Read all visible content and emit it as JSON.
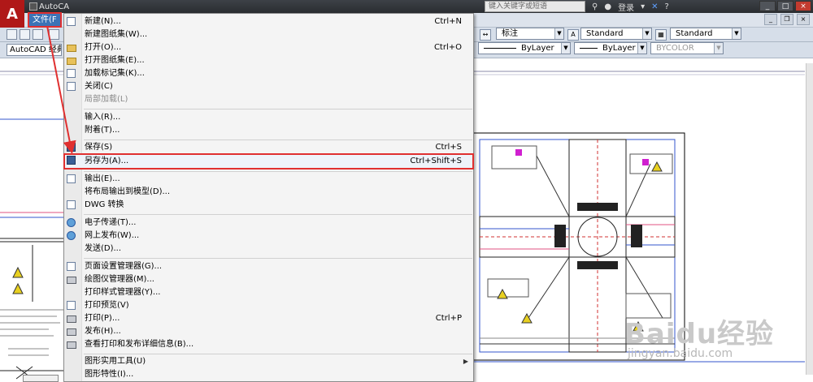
{
  "title_bar": {
    "doc_title": "AutoCA",
    "search_placeholder": "键入关键字或短语",
    "login_label": "登录",
    "window_buttons": [
      "_",
      "□",
      "×"
    ]
  },
  "menu_bar": {
    "file_label": "文件(F"
  },
  "toolbar": {
    "workspace": "AutoCAD 经典",
    "dim_style": "标注",
    "text_style": "Standard",
    "table_style": "Standard",
    "layer_linetype": "ByLayer",
    "layer_lineweight": "ByLayer",
    "color": "BYCOLOR"
  },
  "file_menu": {
    "items": [
      {
        "label": "新建(N)...",
        "shortcut": "Ctrl+N",
        "icon": "new-file-icon",
        "enabled": true
      },
      {
        "label": "新建图纸集(W)...",
        "shortcut": "",
        "icon": "",
        "enabled": true
      },
      {
        "label": "打开(O)...",
        "shortcut": "Ctrl+O",
        "icon": "open-folder-icon",
        "enabled": true
      },
      {
        "label": "打开图纸集(E)...",
        "shortcut": "",
        "icon": "sheetset-icon",
        "enabled": true
      },
      {
        "label": "加载标记集(K)...",
        "shortcut": "",
        "icon": "markup-icon",
        "enabled": true
      },
      {
        "label": "关闭(C)",
        "shortcut": "",
        "icon": "close-file-icon",
        "enabled": true
      },
      {
        "label": "局部加载(L)",
        "shortcut": "",
        "icon": "",
        "enabled": false
      },
      {
        "label": "输入(R)...",
        "shortcut": "",
        "icon": "",
        "enabled": true
      },
      {
        "label": "附着(T)...",
        "shortcut": "",
        "icon": "",
        "enabled": true
      },
      {
        "label": "保存(S)",
        "shortcut": "Ctrl+S",
        "icon": "save-icon",
        "enabled": true
      },
      {
        "label": "另存为(A)...",
        "shortcut": "Ctrl+Shift+S",
        "icon": "save-as-icon",
        "enabled": true,
        "highlighted": true
      },
      {
        "label": "输出(E)...",
        "shortcut": "",
        "icon": "export-icon",
        "enabled": true
      },
      {
        "label": "将布局输出到模型(D)...",
        "shortcut": "",
        "icon": "",
        "enabled": true
      },
      {
        "label": "DWG 转换",
        "shortcut": "",
        "icon": "dwg-convert-icon",
        "enabled": true
      },
      {
        "label": "电子传递(T)...",
        "shortcut": "",
        "icon": "etransmit-icon",
        "enabled": true
      },
      {
        "label": "网上发布(W)...",
        "shortcut": "",
        "icon": "publish-web-icon",
        "enabled": true
      },
      {
        "label": "发送(D)...",
        "shortcut": "",
        "icon": "",
        "enabled": true
      },
      {
        "label": "页面设置管理器(G)...",
        "shortcut": "",
        "icon": "page-setup-icon",
        "enabled": true
      },
      {
        "label": "绘图仪管理器(M)...",
        "shortcut": "",
        "icon": "plotter-icon",
        "enabled": true
      },
      {
        "label": "打印样式管理器(Y)...",
        "shortcut": "",
        "icon": "",
        "enabled": true
      },
      {
        "label": "打印预览(V)",
        "shortcut": "",
        "icon": "preview-icon",
        "enabled": true
      },
      {
        "label": "打印(P)...",
        "shortcut": "Ctrl+P",
        "icon": "print-icon",
        "enabled": true
      },
      {
        "label": "发布(H)...",
        "shortcut": "",
        "icon": "publish-icon",
        "enabled": true
      },
      {
        "label": "查看打印和发布详细信息(B)...",
        "shortcut": "",
        "icon": "plot-details-icon",
        "enabled": true
      },
      {
        "label": "图形实用工具(U)",
        "shortcut": "",
        "icon": "",
        "enabled": true,
        "submenu": true
      },
      {
        "label": "图形特性(I)...",
        "shortcut": "",
        "icon": "",
        "enabled": true
      }
    ]
  },
  "watermark": {
    "brand": "Baidu经验",
    "url": "jingyan.baidu.com"
  },
  "colors": {
    "highlight_outline": "#e03030",
    "menu_bg": "#f4f4f4",
    "titlebar_bg": "#2a2d31"
  }
}
